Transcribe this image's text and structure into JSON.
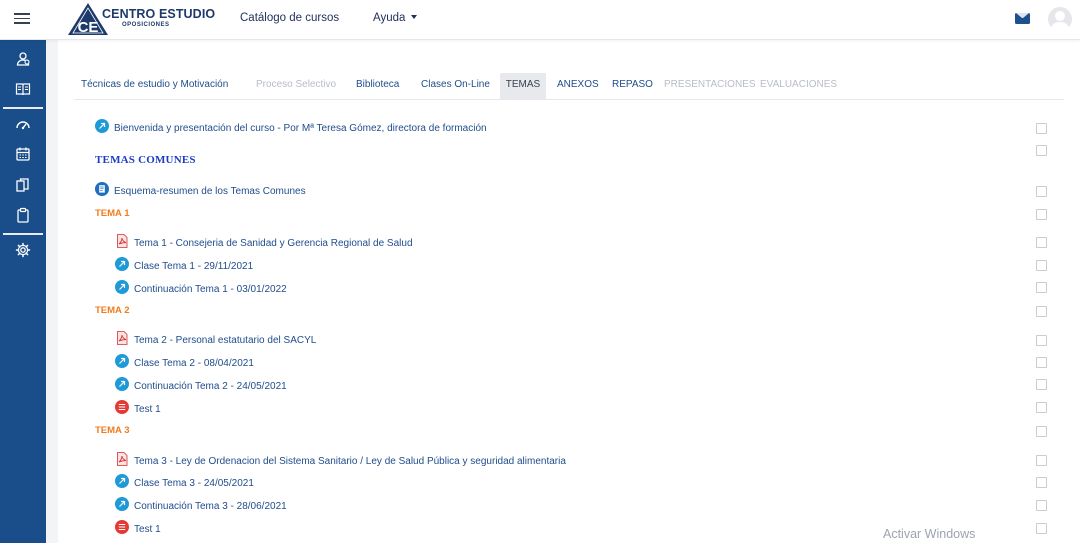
{
  "navbar": {
    "logo_main": "CENTRO ESTUDIO",
    "logo_sub": "OPOSICIONES",
    "logo_letters": "CE",
    "catalog_link": "Catálogo de cursos",
    "help_link": "Ayuda"
  },
  "sidebar": {
    "icons": [
      "users-icon",
      "book-icon",
      "dashboard-icon",
      "calendar-icon",
      "files-icon",
      "clipboard-icon",
      "gear-icon"
    ]
  },
  "tabs": [
    {
      "label": "Técnicas de estudio y Motivación",
      "state": "normal"
    },
    {
      "label": "Proceso Selectivo",
      "state": "disabled"
    },
    {
      "label": "Biblioteca",
      "state": "normal"
    },
    {
      "label": "Clases On-Line",
      "state": "normal"
    },
    {
      "label": "TEMAS",
      "state": "active"
    },
    {
      "label": "ANEXOS",
      "state": "normal"
    },
    {
      "label": "REPASO",
      "state": "normal"
    },
    {
      "label": "PRESENTACIONES",
      "state": "disabled"
    },
    {
      "label": "EVALUACIONES",
      "state": "disabled"
    }
  ],
  "content": {
    "welcome": "Bienvenida y presentación del curso - Por Mª Teresa Gómez, directora de formación",
    "section_common": "TEMAS COMUNES",
    "esquema": "Esquema-resumen de los Temas Comunes",
    "tema1": {
      "title": "TEMA 1",
      "items": [
        "Tema 1 - Consejeria de Sanidad y Gerencia Regional de Salud",
        "Clase Tema 1 - 29/11/2021",
        "Continuación Tema 1 - 03/01/2022"
      ]
    },
    "tema2": {
      "title": "TEMA 2",
      "items": [
        "Tema 2 - Personal estatutario del SACYL",
        "Clase Tema 2 - 08/04/2021",
        "Continuación Tema 2 - 24/05/2021",
        "Test 1"
      ]
    },
    "tema3": {
      "title": "TEMA 3",
      "items": [
        "Tema 3 - Ley de Ordenacion del Sistema Sanitario / Ley de Salud Pública y seguridad alimentaria",
        "Clase Tema 3 - 24/05/2021",
        "Continuación Tema 3 - 28/06/2021",
        "Test 1"
      ]
    }
  },
  "watermark": "Activar Windows",
  "colors": {
    "sidebar": "#1a4e8a",
    "link": "#1f4d8c",
    "section_title": "#1d3cc4",
    "tema_title": "#f07c1e",
    "url_icon": "#1e9ad6",
    "quiz_icon": "#e53935",
    "pdf_icon": "#d32f2f"
  }
}
